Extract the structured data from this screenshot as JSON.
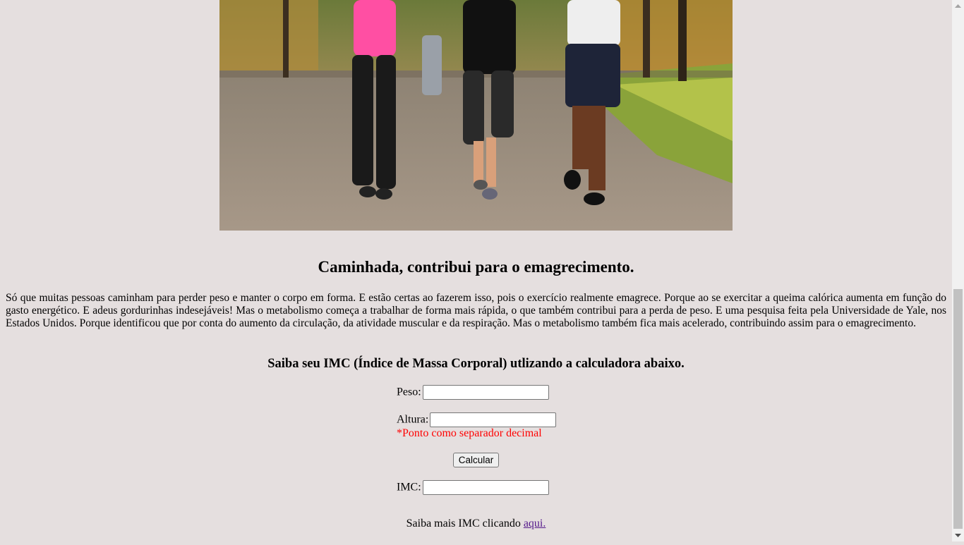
{
  "hero_image": {
    "description_icon": "walking-people-photo-icon"
  },
  "article": {
    "title": "Caminhada, contribui para o emagrecimento.",
    "body": "Só que muitas pessoas caminham para perder peso e manter o corpo em forma. E estão certas ao fazerem isso, pois o exercício realmente emagrece. Porque ao se exercitar a queima calórica aumenta em função do gasto energético. E adeus gordurinhas indesejáveis! Mas o metabolismo começa a trabalhar de forma mais rápida, o que também contribui para a perda de peso. E uma pesquisa feita pela Universidade de Yale, nos Estados Unidos. Porque identificou que por conta do aumento da circulação, da atividade muscular e da respiração. Mas o metabolismo também fica mais acelerado, contribuindo assim para o emagrecimento."
  },
  "calculator": {
    "heading": "Saiba seu IMC (Índice de Massa Corporal) utlizando a calculadora abaixo.",
    "weight_label": "Peso:",
    "weight_value": "",
    "height_label": "Altura:",
    "height_value": "",
    "decimal_note": "*Ponto como separador decimal",
    "calculate_label": "Calcular",
    "result_label": "IMC:",
    "result_value": ""
  },
  "footer": {
    "more_text": "Saiba mais IMC clicando",
    "more_link": "aqui."
  },
  "colors": {
    "background": "#e5dfdf",
    "note": "#ff0000",
    "link": "#551a8b"
  }
}
